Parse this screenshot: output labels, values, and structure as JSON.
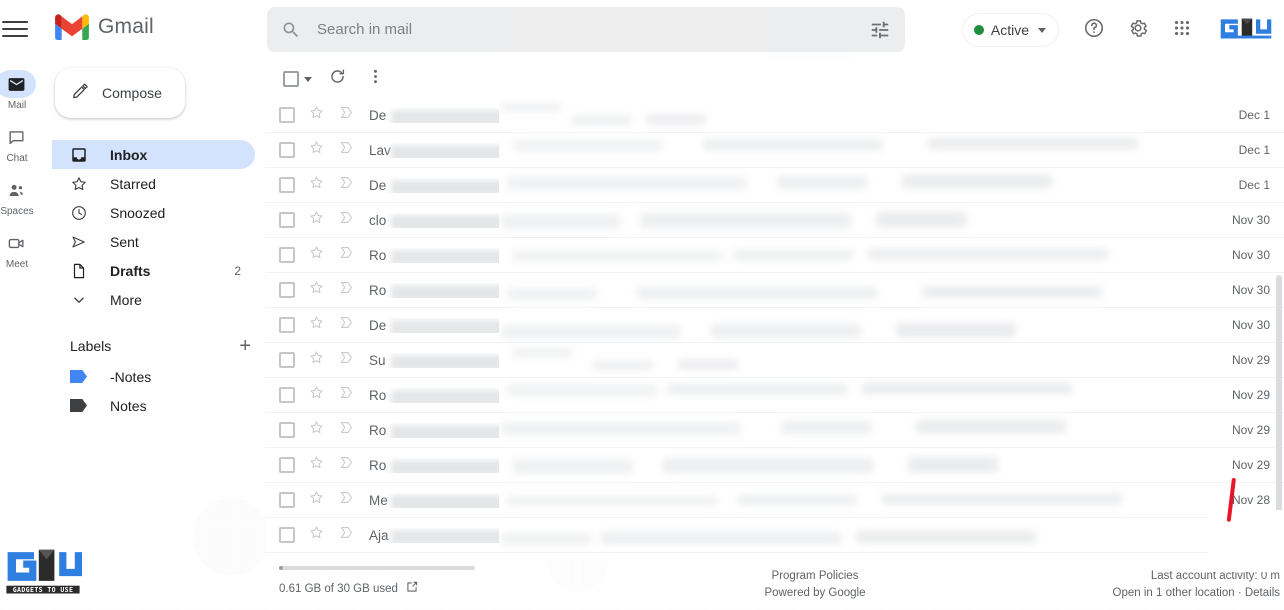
{
  "app": {
    "name": "Gmail",
    "brand_logo_icon": "gmail-m-logo"
  },
  "header": {
    "menu_icon": "hamburger-menu-icon",
    "search": {
      "icon": "search-icon",
      "placeholder": "Search in mail",
      "value": "",
      "options_icon": "search-options-icon"
    },
    "status": {
      "label": "Active",
      "dot_color": "#1e8e3e",
      "caret_icon": "chevron-down-icon"
    },
    "help_icon": "help-question-icon",
    "settings_icon": "gear-icon",
    "apps_icon": "apps-grid-icon",
    "avatar_icon": "gadgets-to-use-logo"
  },
  "rail": {
    "items": [
      {
        "label": "Mail",
        "icon": "mail-envelope-icon",
        "active": true
      },
      {
        "label": "Chat",
        "icon": "chat-bubble-icon",
        "active": false
      },
      {
        "label": "Spaces",
        "icon": "spaces-people-icon",
        "active": false
      },
      {
        "label": "Meet",
        "icon": "meet-video-icon",
        "active": false
      }
    ]
  },
  "sidebar": {
    "compose": {
      "label": "Compose",
      "icon": "pencil-compose-icon"
    },
    "nav": [
      {
        "label": "Inbox",
        "icon": "inbox-icon",
        "count": "",
        "active": true
      },
      {
        "label": "Starred",
        "icon": "star-icon",
        "count": "",
        "active": false
      },
      {
        "label": "Snoozed",
        "icon": "clock-icon",
        "count": "",
        "active": false
      },
      {
        "label": "Sent",
        "icon": "send-paperplane-icon",
        "count": "",
        "active": false
      },
      {
        "label": "Drafts",
        "icon": "draft-file-icon",
        "count": "2",
        "active": false
      },
      {
        "label": "More",
        "icon": "chevron-down-icon",
        "count": "",
        "active": false
      }
    ],
    "labels_header": {
      "title": "Labels",
      "add_icon": "plus-icon",
      "add_label": "+"
    },
    "labels": [
      {
        "name": "-Notes",
        "color": "#4285f4",
        "icon": "label-tag-icon"
      },
      {
        "name": "Notes",
        "color": "#3c4043",
        "icon": "label-tag-icon"
      }
    ]
  },
  "list_toolbar": {
    "select_all_icon": "checkbox-icon",
    "select_all_caret_icon": "chevron-down-icon",
    "refresh_icon": "refresh-icon",
    "more_icon": "more-vertical-icon"
  },
  "mail_list": {
    "row_icons": {
      "checkbox": "checkbox-icon",
      "star": "star-outline-icon",
      "important": "important-marker-icon"
    },
    "rows": [
      {
        "sender": "De",
        "date": "Dec 1"
      },
      {
        "sender": "Lav",
        "date": "Dec 1"
      },
      {
        "sender": "De",
        "date": "Dec 1"
      },
      {
        "sender": "clo",
        "date": "Nov 30"
      },
      {
        "sender": "Ro",
        "date": "Nov 30"
      },
      {
        "sender": "Ro",
        "date": "Nov 30"
      },
      {
        "sender": "De",
        "date": "Nov 30"
      },
      {
        "sender": "Su",
        "date": "Nov 29"
      },
      {
        "sender": "Ro",
        "date": "Nov 29"
      },
      {
        "sender": "Ro",
        "date": "Nov 29"
      },
      {
        "sender": "Ro",
        "date": "Nov 29"
      },
      {
        "sender": "Me",
        "date": "Nov 28"
      },
      {
        "sender": "Aja",
        "date": ""
      }
    ]
  },
  "footer": {
    "storage_text": "0.61 GB of 30 GB used",
    "storage_link_icon": "external-link-icon",
    "program_policies": "Program Policies",
    "powered_by": "Powered by Google",
    "last_activity": "Last account activity: 0 m",
    "open_location": "Open in 1 other location · Details"
  },
  "watermark": {
    "logo_text": "GADGETS TO USE",
    "logo_icon": "gadgets-to-use-logo"
  }
}
